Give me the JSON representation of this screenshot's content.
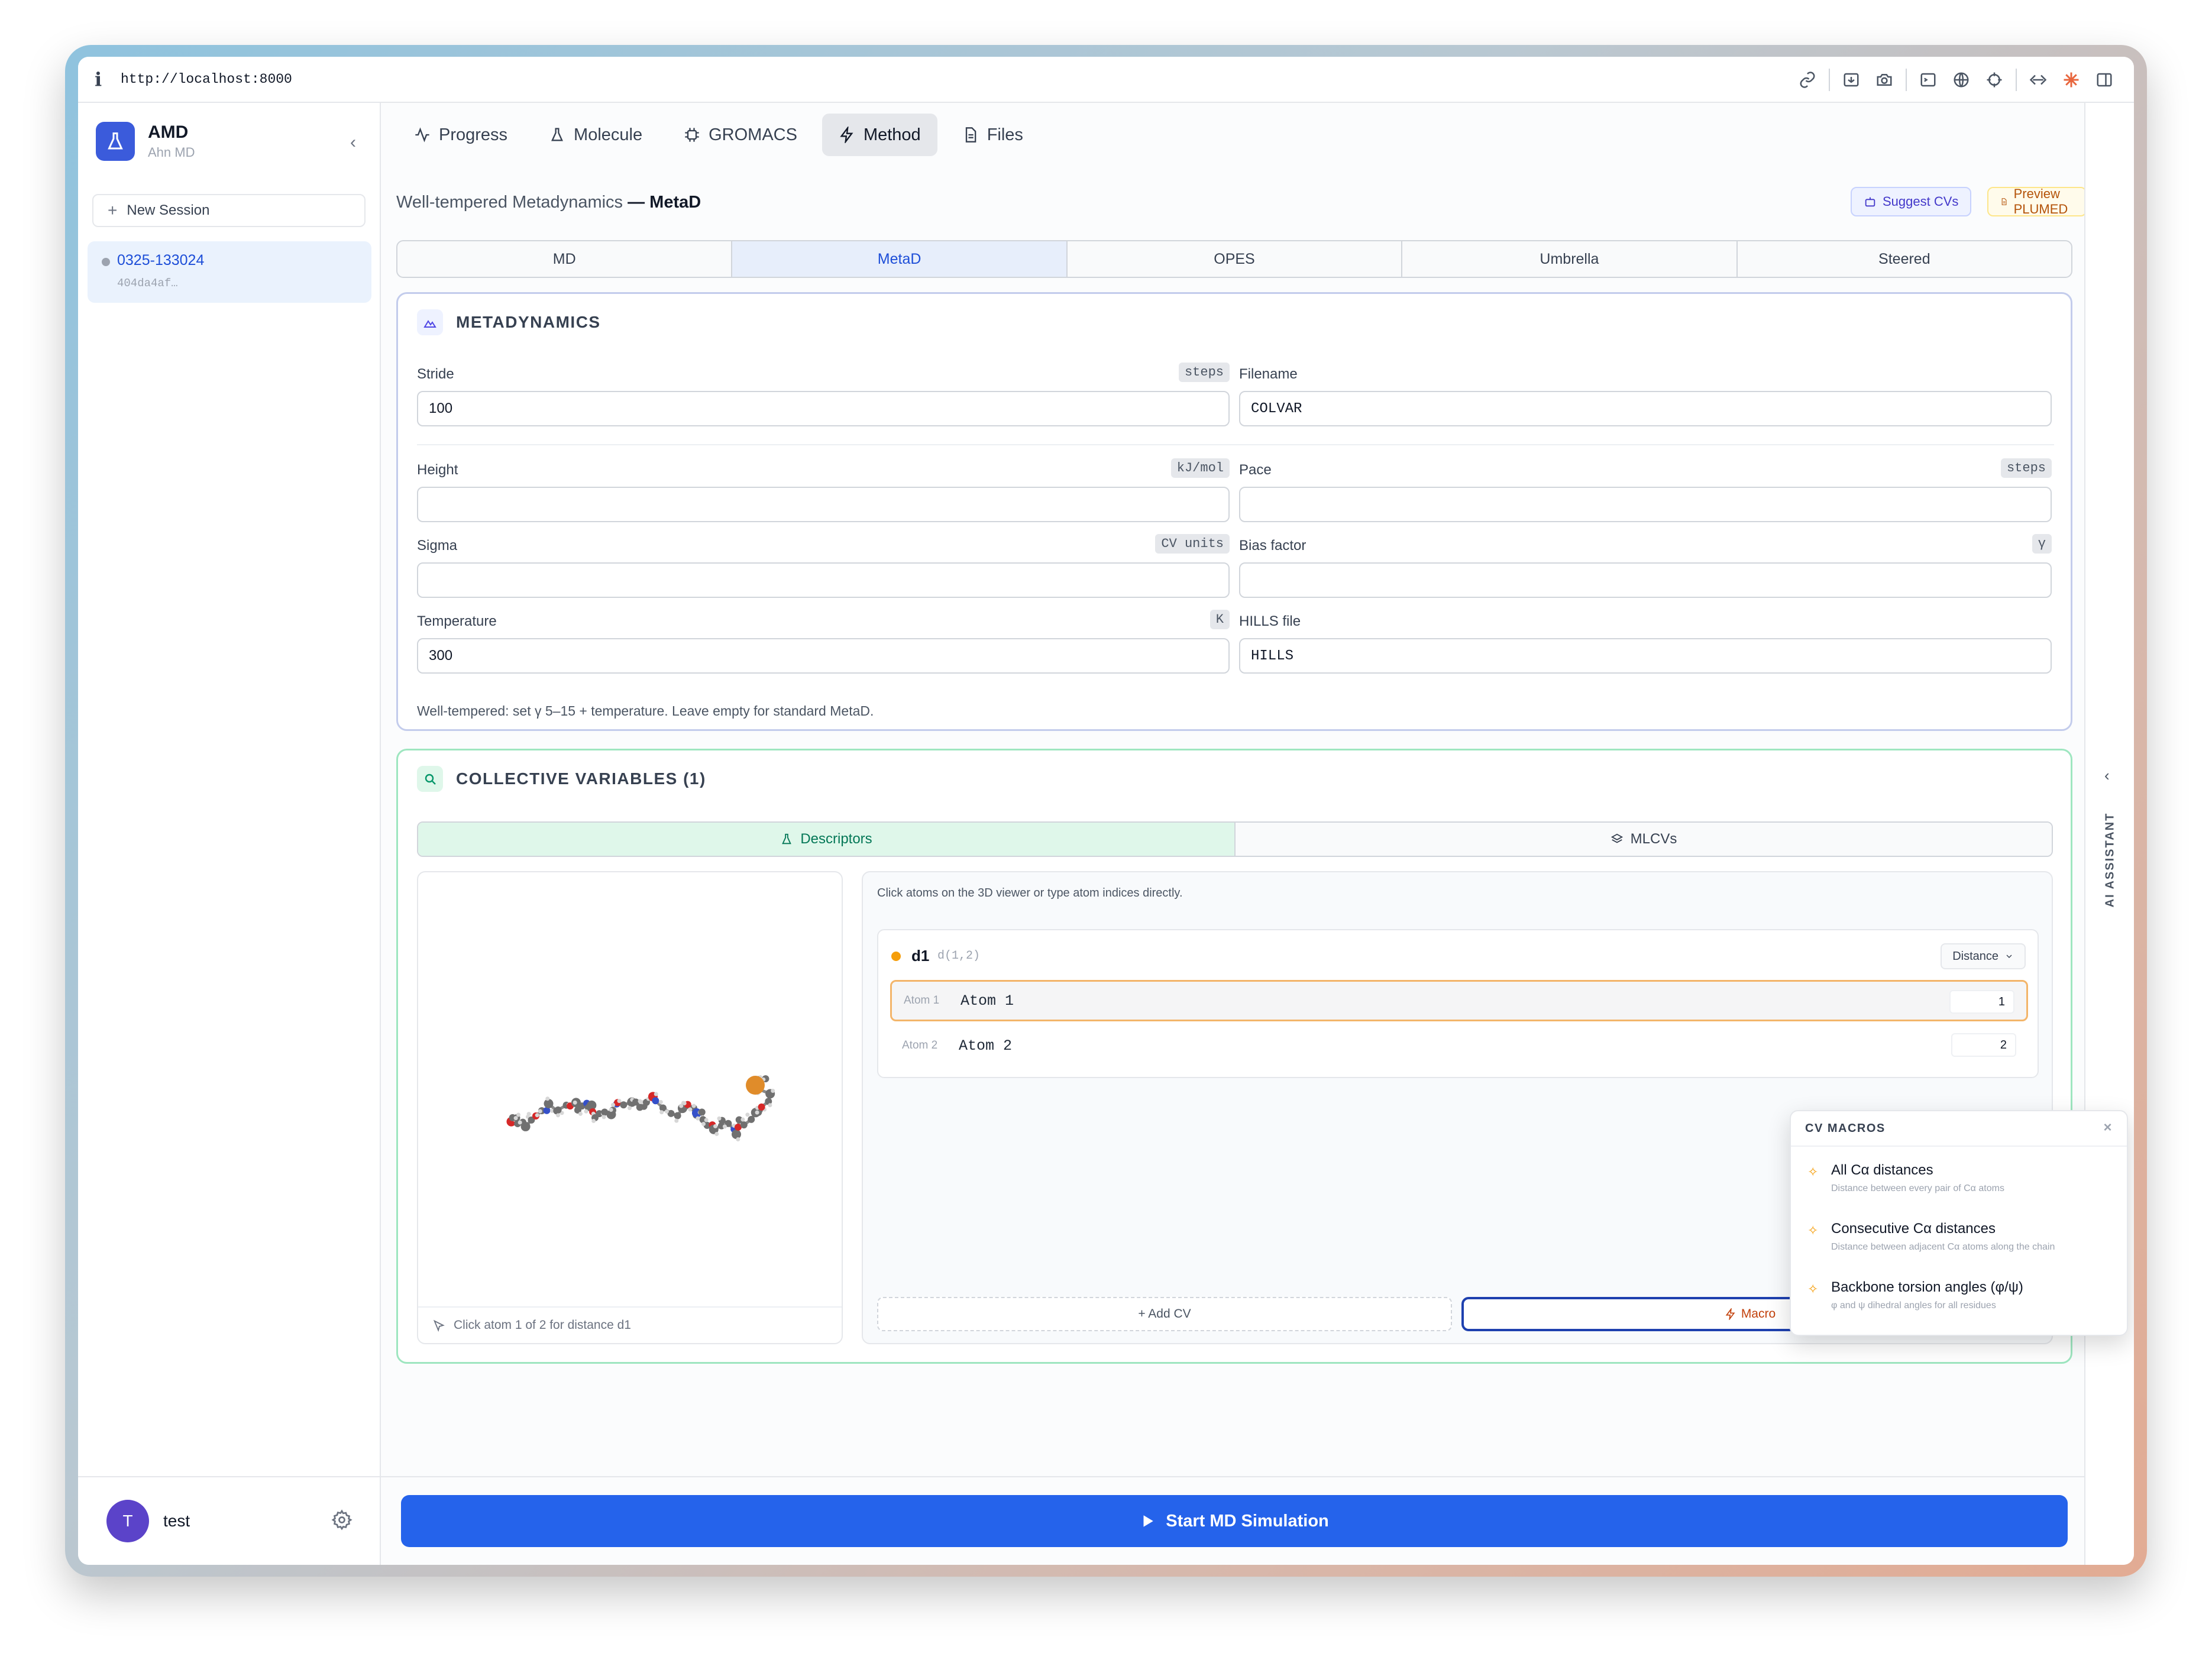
{
  "browser": {
    "url": "http://localhost:8000",
    "info_glyph": "i"
  },
  "sidebar": {
    "app_title": "AMD",
    "app_subtitle": "Ahn MD",
    "collapse_glyph": "‹",
    "new_session": "New Session",
    "sessions": [
      {
        "id": "0325-133024",
        "hash": "404da4af…"
      }
    ],
    "user": {
      "initial": "T",
      "name": "test"
    }
  },
  "tabs": [
    "Progress",
    "Molecule",
    "GROMACS",
    "Method",
    "Files"
  ],
  "active_tab": "Method",
  "header": {
    "title_prefix": "Well-tempered Metadynamics",
    "title_suffix": "— MetaD",
    "suggest_cvs": "Suggest CVs",
    "preview_plumed": "Preview PLUMED"
  },
  "method_tabs": [
    "MD",
    "MetaD",
    "OPES",
    "Umbrella",
    "Steered"
  ],
  "active_method": "MetaD",
  "metad": {
    "title": "METADYNAMICS",
    "stride": {
      "label": "Stride",
      "unit": "steps",
      "value": "100"
    },
    "filename": {
      "label": "Filename",
      "value": "COLVAR"
    },
    "height": {
      "label": "Height",
      "unit": "kJ/mol",
      "value": ""
    },
    "pace": {
      "label": "Pace",
      "unit": "steps",
      "value": ""
    },
    "sigma": {
      "label": "Sigma",
      "unit": "CV units",
      "value": ""
    },
    "bias": {
      "label": "Bias factor",
      "unit": "γ",
      "value": ""
    },
    "temperature": {
      "label": "Temperature",
      "unit": "K",
      "value": "300"
    },
    "hills": {
      "label": "HILLS file",
      "value": "HILLS"
    },
    "hint": "Well-tempered: set γ 5–15 + temperature. Leave empty for standard MetaD."
  },
  "cv": {
    "title": "COLLECTIVE VARIABLES (1)",
    "tabs": [
      "Descriptors",
      "MLCVs"
    ],
    "viewer_hint": "Click atom 1 of 2 for distance d1",
    "instructions": "Click atoms on the 3D viewer or type atom indices directly.",
    "item": {
      "name": "d1",
      "expr": "d(1,2)",
      "type": "Distance",
      "atoms": [
        {
          "tag": "Atom 1",
          "name": "Atom 1",
          "value": "1"
        },
        {
          "tag": "Atom 2",
          "name": "Atom 2",
          "value": "2"
        }
      ]
    },
    "add_cv": "+ Add CV",
    "macro": "Macro"
  },
  "macros": {
    "title": "CV MACROS",
    "close": "×",
    "items": [
      {
        "title": "All Cα distances",
        "desc": "Distance between every pair of Cα atoms"
      },
      {
        "title": "Consecutive Cα distances",
        "desc": "Distance between adjacent Cα atoms along the chain"
      },
      {
        "title": "Backbone torsion angles (φ/ψ)",
        "desc": "φ and ψ dihedral angles for all residues"
      }
    ]
  },
  "start_button": "Start MD Simulation",
  "assistant": {
    "label": "AI ASSISTANT",
    "chevron": "‹"
  },
  "colors": {
    "primary": "#2563eb",
    "metad_border": "#c3ccec",
    "cv_border": "#9ee6c0",
    "accent_orange": "#f59e0b",
    "avatar": "#5b43c9"
  }
}
